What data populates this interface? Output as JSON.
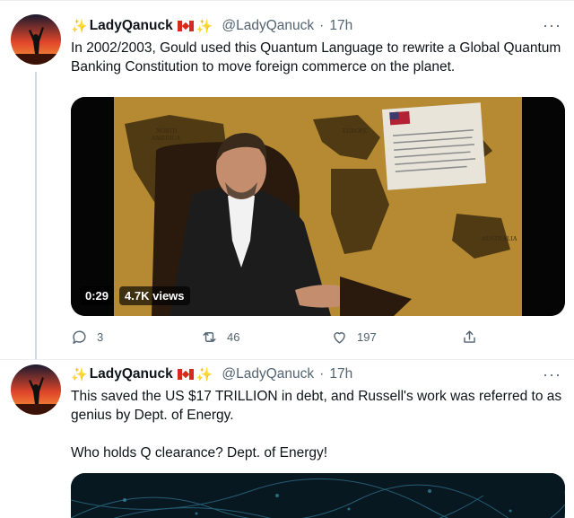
{
  "tweets": [
    {
      "display_name": "LadyQanuck",
      "handle": "@LadyQanuck",
      "separator": "·",
      "time": "17h",
      "text": "In 2002/2003, Gould used this Quantum Language to rewrite a Global Quantum Banking Constitution to move foreign commerce on the planet.",
      "video": {
        "duration": "0:29",
        "views": "4.7K views"
      },
      "stats": {
        "replies": "3",
        "retweets": "46",
        "likes": "197"
      }
    },
    {
      "display_name": "LadyQanuck",
      "handle": "@LadyQanuck",
      "separator": "·",
      "time": "17h",
      "text_line1": "This saved the US $17 TRILLION in debt, and Russell's work was referred to as genius by Dept. of Energy.",
      "text_line2": "Who holds Q clearance? Dept. of Energy!"
    }
  ],
  "icons": {
    "sparkle": "✨",
    "more": "···",
    "reply": "reply-icon",
    "retweet": "retweet-icon",
    "like": "heart-icon",
    "share": "share-icon"
  },
  "colors": {
    "accent": "#1d9bf0",
    "muted": "#536471",
    "divider": "#ebeef0"
  }
}
